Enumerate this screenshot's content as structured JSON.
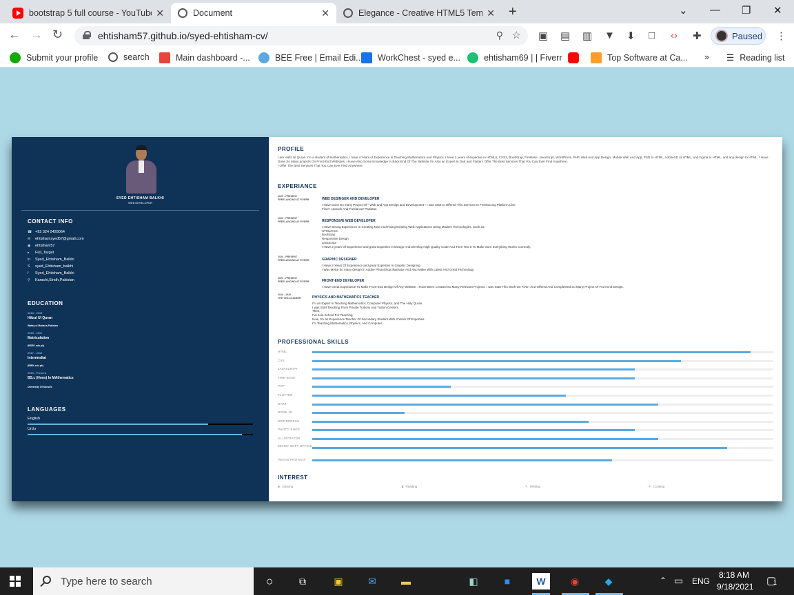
{
  "browser": {
    "tabs": [
      {
        "title": "bootstrap 5 full course - YouTube",
        "icon": "youtube-icon",
        "active": false
      },
      {
        "title": "Document",
        "icon": "globe-icon",
        "active": true
      },
      {
        "title": "Elegance - Creative HTML5 Template",
        "icon": "globe-icon",
        "active": false
      }
    ],
    "url": "ehtisham57.github.io/syed-ehtisham-cv/",
    "profile_label": "Paused",
    "bookmarks": [
      {
        "label": "Submit your profile",
        "icon": "upwork-icon",
        "color": "#14a800"
      },
      {
        "label": "search",
        "icon": "globe-icon",
        "color": "#555555"
      },
      {
        "label": "Main dashboard -...",
        "icon": "dashboard-icon",
        "color": "#e8453c"
      },
      {
        "label": "BEE Free | Email Edi...",
        "icon": "bee-icon",
        "color": "#5aa9e0"
      },
      {
        "label": "WorkChest - syed e...",
        "icon": "workchest-icon",
        "color": "#1a73e8"
      },
      {
        "label": "ehtisham69 | | Fiverr",
        "icon": "fiverr-icon",
        "color": "#1dbf73"
      },
      {
        "label": "",
        "icon": "youtube-icon",
        "color": "#ff0000"
      },
      {
        "label": "Top Software at Ca...",
        "icon": "capterra-icon",
        "color": "#ff9d28"
      }
    ],
    "reading_list": "Reading list"
  },
  "resume": {
    "name": "SYED EHTISHAM BALKHI",
    "role": "WEB DEVELOPER",
    "contact_heading": "CONTACT INFO",
    "contact": [
      {
        "icon": "phone-icon",
        "text": "+92 324 0428064"
      },
      {
        "icon": "email-icon",
        "text": "ehtishamsyed57@gmail.com"
      },
      {
        "icon": "github-icon",
        "text": "ehtisham57"
      },
      {
        "icon": "twitter-icon",
        "text": "Full_Target"
      },
      {
        "icon": "linkedin-icon",
        "text": "Syed_Ehtisham_Balkhi"
      },
      {
        "icon": "skype-icon",
        "text": "syed_Ehtisham_balkhi"
      },
      {
        "icon": "facebook-icon",
        "text": "Syed_Ehtisham_Balkhi"
      },
      {
        "icon": "location-icon",
        "text": "Karachi,Sindh,Pakistan"
      }
    ],
    "education_heading": "EDUCATION",
    "education": [
      {
        "year": "2013 - 2015",
        "degree": "Hifzul Ul Quran",
        "school": "Wafaq ul Madaris,Pakistan"
      },
      {
        "year": "2015 - 2017",
        "degree": "Matriculation",
        "school": "(BSEK.edu.pk)"
      },
      {
        "year": "2017 - 2019",
        "degree": "Intermediat",
        "school": "(BIEK.edu.pk)"
      },
      {
        "year": "2019 - Present",
        "degree": "BS.c (Hons) In MAthematics",
        "school": "University Of Karachi"
      }
    ],
    "languages_heading": "LANGUAGES",
    "languages": [
      {
        "name": "English",
        "level": 0.8
      },
      {
        "name": "Urdu",
        "level": 0.95
      }
    ],
    "profile_heading": "PROFILE",
    "profile_text": "I am Hafiz Ul Quran. I'm a student of Mathematics, I have 4 Years of Experience in Teaching Mathematics And Physics. I have 2 years of expertise in HTML5, CSS3, BootStrap, FireBase, JavaScript, WordPress, PHP, Web And App Design, Mobile Web And App, PSD to HTML, AdobeXD to HTML, and Figma to HTML, and any design to HTML. I Have Done So Many projects On Front-End Websites, I Have Also Some Knowledge In Back-End Of The Website I'm Also an Expert In Dart and Flutter I Offer The Best Services That You Can Ever Find Anywhere.",
    "profile_text2": "I Offer The Best Services That You Can Ever Find Anywhere.",
    "experience_heading": "EXPERIANCE",
    "experience": [
      {
        "date": "2020 - PRESENT",
        "place": "FREELANCING AT FIVERR",
        "title": "WEB DESINGER AND DEVELOPER",
        "lines": [
          "I Have Done So many Project Of \" Web and App Design and Development \" I was Start to Offered This Services In Freelancing Platform Like:",
          "Fiverr ,Upwork And Freelancer Pakistan"
        ]
      },
      {
        "date": "2020 - PRESENT",
        "place": "FREELANCING AT FIVERR",
        "title": "RESPONSIVE WEB DEVELOPER",
        "lines": [
          "I Have Strong Experience In Creating New And Fixing Existing Web Applications Using Modern Technologies, Such as:",
          "HTML/CSS",
          "Bootstrap",
          "Responsive Design",
          "JavaScript",
          "I Have 2 years Of Experience and great Experties In Design And Develop High Quality Code And Then Test It To Make Sure Everything Works Correctly."
        ]
      },
      {
        "date": "2020 - PRESENT",
        "place": "FREELANCING AT FIVERR",
        "title": "GRAPHIC DESIGNER",
        "lines": [
          "I Have 2 Years Of Experience and great Experties In Graphic Designing",
          "I Was MAke So many design In Adobe PhotoShop,Illustrator And Also Make With Latest And Great Technology"
        ]
      },
      {
        "date": "2020 - PRESENT",
        "place": "FREELANCING AT FIVERR",
        "title": "FRONT-END DEVELOPER",
        "lines": [
          "I Have Great Experiance To Make Front-End Design Of Any Website. I Have Been Created So Many Relevant Projects. I was Start This Work On Fiverr And Offered And Compleeted So Many Project Of Fron-End Design."
        ]
      },
      {
        "date": "2018 - 2020",
        "place": "THE YEN ACADEMY",
        "title": "PHYSICS AND MATHEMATICS TEACHER",
        "lines": [
          "I'm an Expert In Teaching Mathematics, Computer Physics, and The Holy Quran.",
          "I was Start Teaching From Private Tuitions And Tuition Centers.",
          "Then,",
          "I've Join School For Teaching.",
          "Now, I'm an Experience Teacher Of Secondary Student With 3 Years Of Experties.",
          "I'm Teaching Mathematics, Physics, And Computer"
        ]
      }
    ],
    "skills_heading": "PROFESSIONAL SKILLS",
    "skills": [
      {
        "name": "HTML",
        "level": 0.95
      },
      {
        "name": "CSS",
        "level": 0.8
      },
      {
        "name": "JAVASCRIPT",
        "level": 0.7
      },
      {
        "name": "FIRE-BASE",
        "level": 0.7
      },
      {
        "name": "PHP",
        "level": 0.3
      },
      {
        "name": "FLUTTER",
        "level": 0.55
      },
      {
        "name": "DART",
        "level": 0.75
      },
      {
        "name": "NODE.JS",
        "level": 0.2
      },
      {
        "name": "WORDPRESS",
        "level": 0.6
      },
      {
        "name": "PHOTO SHOP",
        "level": 0.7
      },
      {
        "name": "ILLUSTRATOR",
        "level": 0.75
      },
      {
        "name": "MICRO-SOFT OFFICE",
        "level": 0.9
      },
      {
        "name": "VEGAS PRO-MAX",
        "level": 0.65
      }
    ],
    "interest_heading": "INTEREST",
    "interests": [
      {
        "icon": "gamepad-icon",
        "label": "Gaming"
      },
      {
        "icon": "book-icon",
        "label": "Reading"
      },
      {
        "icon": "pen-icon",
        "label": "Writting"
      },
      {
        "icon": "utensils-icon",
        "label": "Cooking"
      }
    ]
  },
  "taskbar": {
    "search_placeholder": "Type here to search",
    "language": "ENG",
    "time": "8:18 AM",
    "date": "9/18/2021",
    "notifications": "1"
  }
}
